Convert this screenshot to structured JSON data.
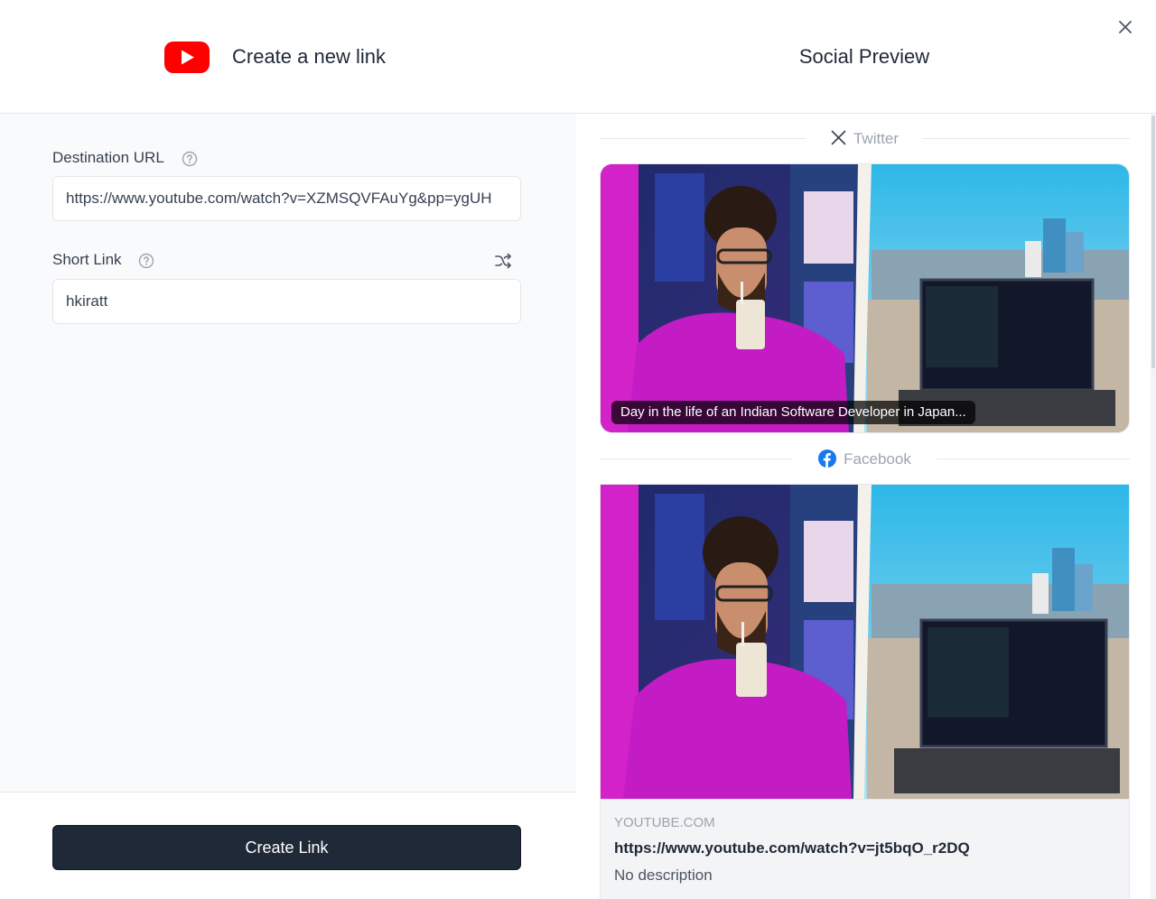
{
  "left": {
    "title": "Create a new link",
    "destination": {
      "label": "Destination URL",
      "value": "https://www.youtube.com/watch?v=XZMSQVFAuYg&pp=ygUH"
    },
    "short_link": {
      "label": "Short Link",
      "value": "hkiratt"
    },
    "create_button": "Create Link"
  },
  "right": {
    "title": "Social Preview",
    "twitter": {
      "label": "Twitter",
      "caption": "Day in the life of an Indian Software Developer in Japan..."
    },
    "facebook": {
      "label": "Facebook",
      "domain": "YOUTUBE.COM",
      "title": "https://www.youtube.com/watch?v=jt5bqO_r2DQ",
      "description": "No description"
    }
  },
  "colors": {
    "youtube_red": "#ff0000",
    "button_dark": "#1f2937",
    "facebook_blue": "#1877f2",
    "sweater_magenta": "#c41cc4",
    "sky_cyan": "#29b6e6"
  },
  "icons": {
    "brand": "youtube-logo-icon",
    "help": "question-circle-icon",
    "shuffle": "shuffle-icon",
    "close": "close-icon",
    "twitter": "x-logo-icon",
    "facebook": "facebook-logo-icon"
  }
}
